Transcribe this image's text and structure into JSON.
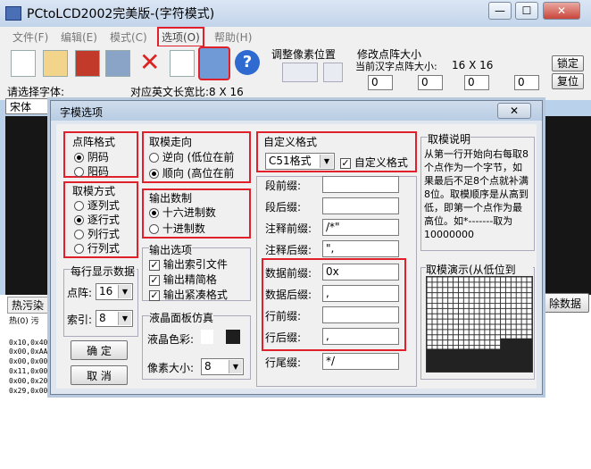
{
  "window": {
    "title": "PCtoLCD2002完美版-(字符模式)",
    "min": "—",
    "max": "☐",
    "close": "✕"
  },
  "menu": [
    "文件(F)",
    "编辑(E)",
    "模式(C)",
    "选项(O)",
    "帮助(H)"
  ],
  "toolbar": {
    "adjust_label": "调整像素位置",
    "size_group_label": "修改点阵大小",
    "current_size_label": "当前汉字点阵大小:",
    "current_size_value": "16 X 16",
    "lock_button": "锁定",
    "reset_button": "复位",
    "spin_values": [
      "0",
      "0",
      "0",
      "0"
    ]
  },
  "font": {
    "prompt": "请选择字体:",
    "en_width": "对应英文长宽比:8 X 16",
    "name": "宋体"
  },
  "left": {
    "tab_label": "热污染",
    "row_text": "热(0) 污",
    "hex_lines": [
      "0x10,0x40",
      "0x00,0xAA",
      "0x00,0x00",
      "0x11,0x00",
      "0x00,0x20",
      "0x29,0x00"
    ]
  },
  "right": {
    "delete_button": "除数据"
  },
  "dialog": {
    "title": "字模选项",
    "close": "✕",
    "dot_format": {
      "title": "点阵格式",
      "options": [
        "阴码",
        "阳码"
      ],
      "selected": 0
    },
    "take_mode": {
      "title": "取模方式",
      "options": [
        "逐列式",
        "逐行式",
        "列行式",
        "行列式"
      ],
      "selected": 1
    },
    "take_direction": {
      "title": "取模走向",
      "options": [
        "逆向 (低位在前",
        "顺向 (高位在前"
      ],
      "selected": 1
    },
    "output_base": {
      "title": "输出数制",
      "options": [
        "十六进制数",
        "十进制数"
      ],
      "selected": 0
    },
    "output_options": {
      "title": "输出选项",
      "items": [
        "输出索引文件",
        "输出精简格",
        "输出紧凑格式"
      ],
      "checked": [
        true,
        true,
        true
      ]
    },
    "per_row": {
      "title": "每行显示数据",
      "dot_label": "点阵:",
      "dot_value": "16",
      "index_label": "索引:",
      "index_value": "8"
    },
    "ok": "确 定",
    "cancel": "取 消",
    "lcd": {
      "title": "液晶面板仿真",
      "color_label": "液晶色彩:",
      "pixel_label": "像素大小:",
      "pixel_value": "8"
    },
    "custom": {
      "title": "自定义格式",
      "format": "C51格式",
      "custom_check": "自定义格式",
      "rows": [
        {
          "label": "段前缀:",
          "value": ""
        },
        {
          "label": "段后缀:",
          "value": ""
        },
        {
          "label": "注释前缀:",
          "value": "/*\""
        },
        {
          "label": "注释后缀:",
          "value": "\","
        },
        {
          "label": "数据前缀:",
          "value": "0x"
        },
        {
          "label": "数据后缀:",
          "value": ","
        },
        {
          "label": "行前缀:",
          "value": ""
        },
        {
          "label": "行后缀:",
          "value": ","
        },
        {
          "label": "行尾缀:",
          "value": "*/"
        }
      ]
    },
    "desc": {
      "title": "取模说明",
      "text": "从第一行开始向右每取8个点作为一个字节，如果最后不足8个点就补满8位。取模顺序是从高到低，即第一个点作为最高位。如*-------取为10000000"
    },
    "demo": {
      "title": "取模演示(从低位到"
    }
  },
  "colors": {
    "highlight": "#e0202a",
    "lcd_color": "#1e1e1e"
  }
}
